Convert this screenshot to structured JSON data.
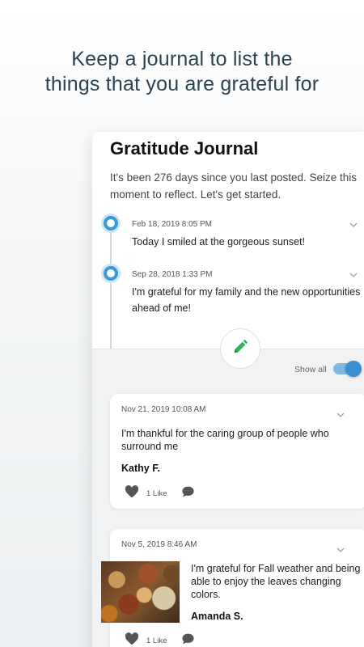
{
  "headline": {
    "line1": "Keep a journal to list the",
    "line2": "things that you are grateful for"
  },
  "journal": {
    "title": "Gratitude Journal",
    "subtitle": "It's been 276 days since you last posted. Seize this moment to reflect. Let's get started.",
    "timeline": [
      {
        "date": "Feb 18, 2019 8:05 PM",
        "text": "Today I smiled at the gorgeous sunset!"
      },
      {
        "date": "Sep 28, 2018 1:33 PM",
        "text": "I'm grateful for my family and the new opportunities ahead of me!"
      }
    ],
    "show_all_label": "Show all",
    "show_all_on": true
  },
  "posts": [
    {
      "date": "Nov 21, 2019 10:08 AM",
      "text": "I'm thankful for the caring group of people who surround me",
      "author": "Kathy F.",
      "likes": "1 Like"
    },
    {
      "date": "Nov 5, 2019 8:46 AM",
      "text": "I'm grateful for Fall weather and being able to enjoy the leaves changing colors.",
      "author": "Amanda S.",
      "likes": "1 Like"
    }
  ],
  "colors": {
    "accent": "#3a9ad9",
    "pencil": "#2fb35a",
    "headline": "#2c4452"
  },
  "icons": {
    "edit": "pencil-icon",
    "like": "heart-icon",
    "comment": "comment-icon",
    "expand": "chevron-down-icon"
  }
}
